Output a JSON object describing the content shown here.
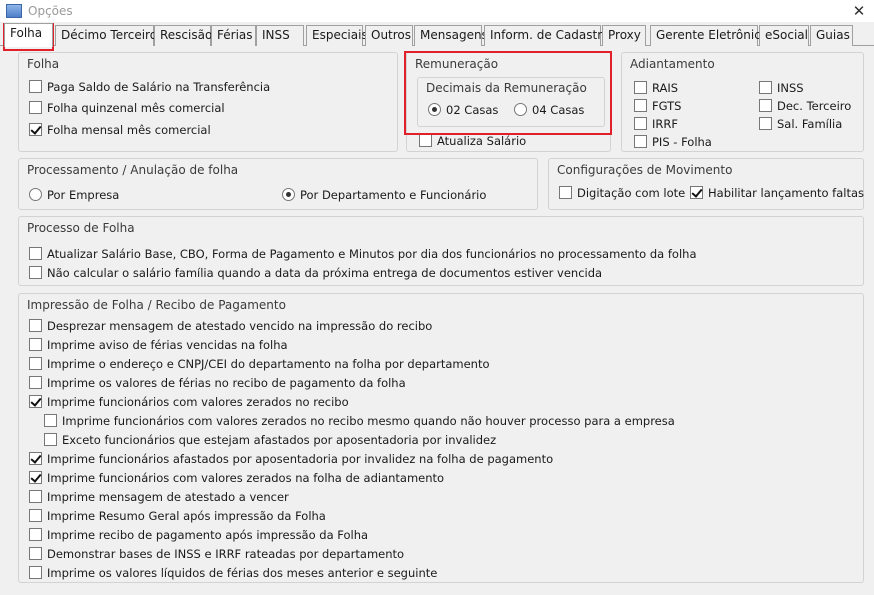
{
  "window": {
    "title": "Opções",
    "close_glyph": "✕"
  },
  "tabs": [
    {
      "label": "Folha"
    },
    {
      "label": "Décimo Terceiro"
    },
    {
      "label": "Rescisão"
    },
    {
      "label": "Férias"
    },
    {
      "label": "INSS"
    },
    {
      "label": "Especiais"
    },
    {
      "label": "Outros"
    },
    {
      "label": "Mensagens"
    },
    {
      "label": "Inform. de Cadastro"
    },
    {
      "label": "Proxy"
    },
    {
      "label": "Gerente Eletrônico"
    },
    {
      "label": "eSocial"
    },
    {
      "label": "Guias"
    }
  ],
  "folha": {
    "title": "Folha",
    "items": [
      {
        "label": "Paga Saldo de Salário na Transferência",
        "checked": false
      },
      {
        "label": "Folha quinzenal mês comercial",
        "checked": false
      },
      {
        "label": "Folha mensal mês comercial",
        "checked": true
      }
    ]
  },
  "remuneracao": {
    "title": "Remuneração",
    "decimais_title": "Decimais da Remuneração",
    "options": [
      {
        "label": "02 Casas",
        "selected": true
      },
      {
        "label": "04 Casas",
        "selected": false
      }
    ],
    "atualiza": {
      "label": "Atualiza Salário",
      "checked": false
    }
  },
  "adiantamento": {
    "title": "Adiantamento",
    "left": [
      {
        "label": "RAIS",
        "checked": false
      },
      {
        "label": "FGTS",
        "checked": false
      },
      {
        "label": "IRRF",
        "checked": false
      },
      {
        "label": "PIS - Folha",
        "checked": false
      }
    ],
    "right": [
      {
        "label": "INSS",
        "checked": false
      },
      {
        "label": "Dec. Terceiro",
        "checked": false
      },
      {
        "label": "Sal. Família",
        "checked": false
      }
    ]
  },
  "processamento": {
    "title": "Processamento / Anulação de folha",
    "options": [
      {
        "label": "Por Empresa",
        "selected": false
      },
      {
        "label": "Por Departamento e Funcionário",
        "selected": true
      }
    ]
  },
  "movimento": {
    "title": "Configurações de Movimento",
    "items": [
      {
        "label": "Digitação com lote",
        "checked": false
      },
      {
        "label": "Habilitar lançamento faltas",
        "checked": true
      }
    ]
  },
  "processo": {
    "title": "Processo de Folha",
    "items": [
      {
        "label": "Atualizar Salário Base, CBO, Forma de Pagamento e Minutos por dia dos funcionários no processamento da folha",
        "checked": false
      },
      {
        "label": "Não calcular o salário família quando a data da próxima entrega de documentos estiver vencida",
        "checked": false
      }
    ]
  },
  "impressao": {
    "title": "Impressão de Folha / Recibo de Pagamento",
    "items": [
      {
        "label": "Desprezar mensagem de atestado vencido na impressão do recibo",
        "checked": false,
        "indent": false
      },
      {
        "label": "Imprime aviso de férias vencidas na folha",
        "checked": false,
        "indent": false
      },
      {
        "label": "Imprime o endereço e CNPJ/CEI do departamento na folha por departamento",
        "checked": false,
        "indent": false
      },
      {
        "label": "Imprime os valores de férias no recibo de pagamento da folha",
        "checked": false,
        "indent": false
      },
      {
        "label": "Imprime funcionários com valores zerados no recibo",
        "checked": true,
        "indent": false
      },
      {
        "label": "Imprime funcionários com valores zerados no recibo mesmo quando não houver processo para a empresa",
        "checked": false,
        "indent": true
      },
      {
        "label": "Exceto funcionários que estejam afastados por aposentadoria por invalidez",
        "checked": false,
        "indent": true
      },
      {
        "label": "Imprime funcionários afastados por aposentadoria por invalidez na folha de pagamento",
        "checked": true,
        "indent": false
      },
      {
        "label": "Imprime funcionários com valores zerados na folha de adiantamento",
        "checked": true,
        "indent": false
      },
      {
        "label": "Imprime mensagem de  atestado a vencer",
        "checked": false,
        "indent": false
      },
      {
        "label": "Imprime Resumo Geral após impressão da Folha",
        "checked": false,
        "indent": false
      },
      {
        "label": "Imprime recibo de pagamento após impressão da Folha",
        "checked": false,
        "indent": false
      },
      {
        "label": "Demonstrar bases de INSS e IRRF rateadas por departamento",
        "checked": false,
        "indent": false
      },
      {
        "label": "Imprime os valores líquidos de férias dos meses anterior e seguinte",
        "checked": false,
        "indent": false
      }
    ]
  },
  "colors": {
    "highlight": "#e0202a"
  }
}
